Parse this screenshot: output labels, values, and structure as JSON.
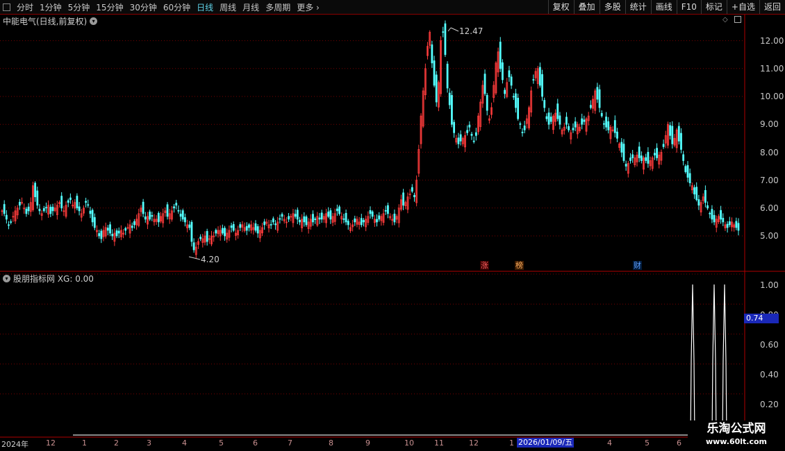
{
  "toolbar": {
    "tabs": [
      "分时",
      "1分钟",
      "5分钟",
      "15分钟",
      "30分钟",
      "60分钟",
      "日线",
      "周线",
      "月线",
      "多周期",
      "更多"
    ],
    "active_tab": "日线",
    "right_buttons": [
      "复权",
      "叠加",
      "多股",
      "统计",
      "画线",
      "F10",
      "标记",
      "+自选",
      "返回"
    ]
  },
  "main_chart": {
    "title": "中能电气(日线,前复权)",
    "y_ticks": [
      "12.00",
      "11.00",
      "10.00",
      "9.00",
      "8.00",
      "7.00",
      "6.00",
      "5.00"
    ],
    "high_label": "12.47",
    "low_label": "4.20",
    "tags": {
      "zhang": "涨",
      "bang": "榜",
      "cai": "财"
    }
  },
  "indicator": {
    "title": "股朋指标网 XG: 0.00",
    "y_ticks": [
      "1.00",
      "0.80",
      "0.60",
      "0.40",
      "0.20"
    ],
    "cursor_value": "0.74"
  },
  "xaxis": {
    "year_label": "2024年",
    "month_labels": [
      "12",
      "1",
      "2",
      "3",
      "4",
      "5",
      "6",
      "7",
      "8",
      "9",
      "10",
      "11",
      "12",
      "1",
      "3",
      "4",
      "5",
      "6"
    ],
    "cursor_date": "2026/01/09/五"
  },
  "watermark": {
    "line1": "乐淘公式网",
    "line2": "www.60lt.com"
  },
  "colors": {
    "up": "#ff3c3c",
    "down": "#54ffff",
    "grid": "#7a0000",
    "border": "#b00000",
    "highlight": "#1a28b8"
  },
  "price_series": [
    5.9,
    5.8,
    5.6,
    5.4,
    5.5,
    5.7,
    5.9,
    6.0,
    6.1,
    6.2,
    6.0,
    5.8,
    5.9,
    6.2,
    6.8,
    6.4,
    6.1,
    5.9,
    5.8,
    5.9,
    6.0,
    6.1,
    5.8,
    5.9,
    6.0,
    6.1,
    6.2,
    6.0,
    5.9,
    6.1,
    6.2,
    6.3,
    6.1,
    6.2,
    6.0,
    5.9,
    5.8,
    6.0,
    6.2,
    6.1,
    5.8,
    5.5,
    5.3,
    5.2,
    5.0,
    4.9,
    5.2,
    5.3,
    5.2,
    5.1,
    5.0,
    5.1,
    5.0,
    5.1,
    5.2,
    5.1,
    5.2,
    5.3,
    5.4,
    5.3,
    5.4,
    5.6,
    5.8,
    6.0,
    5.8,
    5.6,
    5.7,
    5.6,
    5.7,
    5.6,
    5.6,
    5.5,
    5.7,
    5.8,
    5.9,
    5.7,
    5.8,
    5.9,
    6.0,
    6.1,
    5.9,
    5.7,
    5.6,
    5.5,
    5.4,
    5.3,
    4.8,
    4.5,
    4.6,
    4.8,
    4.9,
    4.9,
    5.0,
    4.8,
    4.9,
    5.0,
    5.0,
    5.1,
    5.2,
    5.2,
    5.1,
    5.0,
    5.1,
    5.2,
    5.3,
    5.2,
    5.1,
    5.2,
    5.3,
    5.4,
    5.3,
    5.2,
    5.3,
    5.4,
    5.3,
    5.2,
    5.1,
    5.2,
    5.3,
    5.4,
    5.5,
    5.4,
    5.4,
    5.5,
    5.4,
    5.5,
    5.6,
    5.7,
    5.6,
    5.5,
    5.6,
    5.7,
    5.8,
    5.7,
    5.6,
    5.5,
    5.6,
    5.5,
    5.4,
    5.5,
    5.6,
    5.5,
    5.6,
    5.7,
    5.6,
    5.6,
    5.7,
    5.8,
    5.7,
    5.6,
    5.7,
    5.8,
    5.9,
    5.8,
    5.7,
    5.6,
    5.5,
    5.4,
    5.3,
    5.4,
    5.5,
    5.6,
    5.5,
    5.4,
    5.5,
    5.6,
    5.7,
    5.8,
    5.7,
    5.6,
    5.5,
    5.6,
    5.7,
    5.8,
    5.9,
    5.8,
    5.7,
    5.6,
    5.5,
    5.7,
    6.0,
    6.3,
    6.1,
    6.2,
    6.4,
    6.5,
    6.6,
    6.4,
    7.0,
    8.1,
    9.3,
    10.2,
    11.0,
    11.8,
    12.3,
    11.2,
    10.4,
    9.8,
    10.5,
    12.0,
    12.3,
    11.5,
    10.3,
    9.7,
    9.0,
    8.7,
    8.5,
    8.3,
    8.4,
    8.5,
    8.6,
    8.7,
    8.9,
    8.6,
    8.4,
    8.6,
    9.3,
    9.8,
    10.4,
    10.1,
    9.5,
    9.2,
    9.6,
    10.4,
    11.2,
    11.6,
    11.0,
    10.6,
    10.1,
    10.5,
    10.7,
    10.4,
    10.0,
    9.6,
    9.2,
    9.0,
    8.7,
    8.8,
    9.2,
    9.6,
    10.2,
    10.6,
    10.9,
    11.0,
    10.4,
    10.0,
    9.6,
    9.2,
    9.0,
    9.1,
    9.3,
    9.4,
    9.2,
    9.0,
    8.8,
    8.9,
    9.0,
    8.8,
    8.7,
    8.8,
    8.9,
    9.0,
    8.9,
    9.0,
    9.1,
    9.2,
    9.3,
    9.6,
    9.9,
    10.2,
    9.9,
    9.6,
    9.3,
    9.0,
    8.9,
    8.8,
    8.9,
    8.8,
    8.7,
    8.5,
    8.3,
    8.0,
    7.7,
    7.5,
    7.6,
    7.7,
    7.8,
    7.8,
    7.9,
    7.8,
    7.7,
    7.8,
    7.7,
    7.6,
    7.7,
    7.8,
    7.9,
    7.8,
    7.9,
    8.0,
    8.2,
    8.6,
    9.0,
    8.6,
    8.3,
    8.5,
    8.8,
    8.4,
    8.1,
    7.7,
    7.3,
    7.1,
    6.9,
    6.8,
    6.5,
    6.3,
    6.1,
    6.2,
    6.4,
    6.2,
    6.0,
    5.8,
    5.6,
    5.5,
    5.6,
    5.7,
    5.6,
    5.5,
    5.4,
    5.3,
    5.4,
    5.5,
    5.4,
    5.3,
    5.2
  ]
}
